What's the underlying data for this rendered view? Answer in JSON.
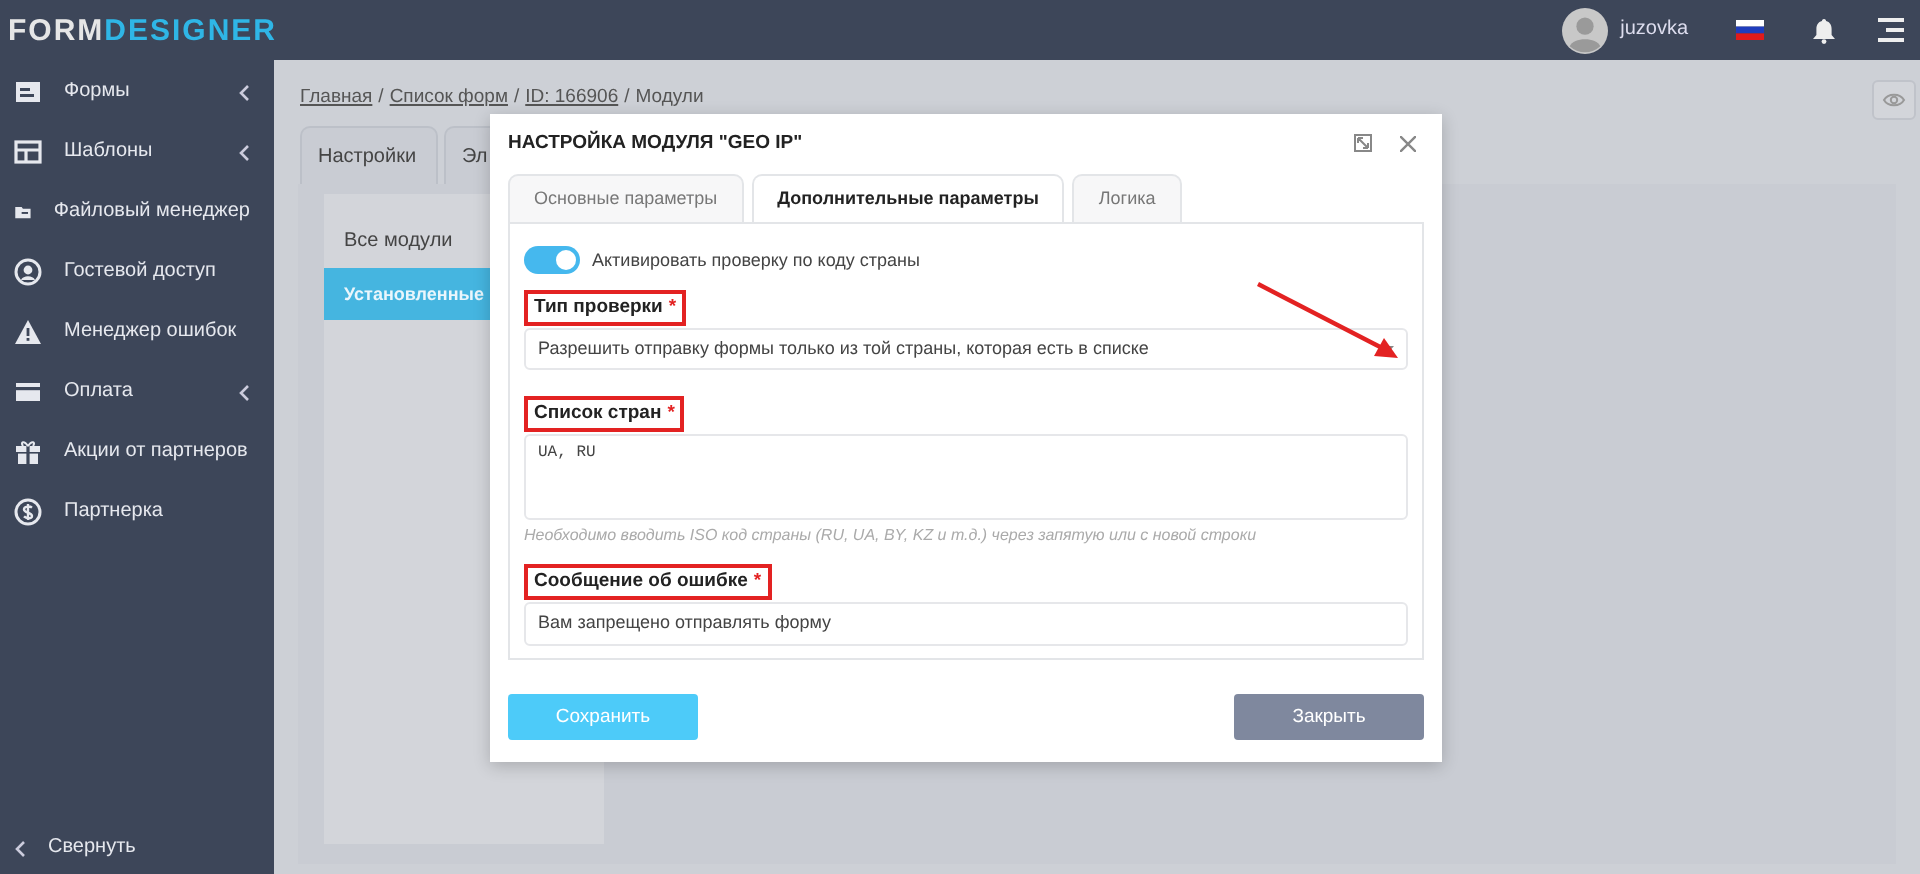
{
  "header": {
    "logo": {
      "first": "FORM",
      "second": "DESIGNER"
    },
    "user": "juzovka"
  },
  "sidebar": {
    "items": [
      {
        "label": "Формы",
        "submenu": true
      },
      {
        "label": "Шаблоны",
        "submenu": true
      },
      {
        "label": "Файловый менеджер",
        "submenu": false
      },
      {
        "label": "Гостевой доступ",
        "submenu": false
      },
      {
        "label": "Менеджер ошибок",
        "submenu": false
      },
      {
        "label": "Оплата",
        "submenu": true
      },
      {
        "label": "Акции от партнеров",
        "submenu": false
      },
      {
        "label": "Партнерка",
        "submenu": false
      }
    ],
    "collapse": "Свернуть"
  },
  "breadcrumb": [
    {
      "kind": "link",
      "text": "Главная"
    },
    {
      "kind": "separator",
      "text": "/"
    },
    {
      "kind": "link",
      "text": "Список форм"
    },
    {
      "kind": "separator",
      "text": "/"
    },
    {
      "kind": "link",
      "text": "ID: 166906"
    },
    {
      "kind": "separator",
      "text": "/"
    },
    {
      "kind": "current",
      "text": "Модули"
    }
  ],
  "page_tabs": [
    {
      "label": "Настройки",
      "selected": false
    },
    {
      "label": "Эл",
      "selected": false
    }
  ],
  "modules_menu": [
    {
      "label": "Все модули",
      "selected": false
    },
    {
      "label": "Установленные",
      "selected": true
    }
  ],
  "modal": {
    "title": "НАСТРОЙКА МОДУЛЯ \"GEO IP\"",
    "tabs": [
      {
        "label": "Основные параметры",
        "selected": false
      },
      {
        "label": "Дополнительные параметры",
        "selected": true
      },
      {
        "label": "Логика",
        "selected": false
      }
    ],
    "toggle": {
      "label": "Активировать проверку по коду страны",
      "on": true
    },
    "fields": [
      {
        "kind": "select",
        "label": "Тип проверки",
        "required_mark": "*",
        "highlighted": true,
        "value": "Разрешить отправку формы только из той страны, которая есть в списке"
      },
      {
        "kind": "textarea",
        "label": "Список стран",
        "required_mark": "*",
        "highlighted": true,
        "value": "UA, RU",
        "help": "Необходимо вводить ISO код страны (RU, UA, BY, KZ и т.д.) через запятую или с новой строки"
      },
      {
        "kind": "input",
        "label": "Сообщение об ошибке",
        "required_mark": "*",
        "highlighted": true,
        "value": "Вам запрещено отправлять форму"
      }
    ],
    "save": "Сохранить",
    "close": "Закрыть"
  }
}
